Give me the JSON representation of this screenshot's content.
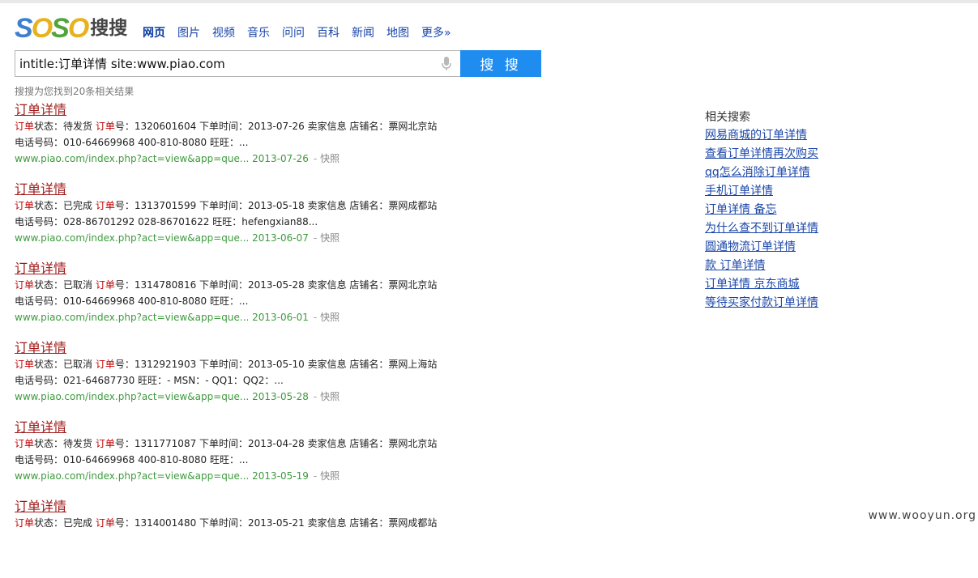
{
  "logo": {
    "text_soso": "SOSO",
    "text_cn": "搜搜"
  },
  "nav": [
    {
      "label": "网页",
      "active": true
    },
    {
      "label": "图片"
    },
    {
      "label": "视频"
    },
    {
      "label": "音乐"
    },
    {
      "label": "问问"
    },
    {
      "label": "百科"
    },
    {
      "label": "新闻"
    },
    {
      "label": "地图"
    },
    {
      "label": "更多»"
    }
  ],
  "search": {
    "query": "intitle:订单详情 site:www.piao.com",
    "button_label": "搜 搜"
  },
  "result_count": "搜搜为您找到20条相关结果",
  "results": [
    {
      "title": "订单详情",
      "line1_pre": "",
      "hl1": "订单",
      "mid1": "状态：待发货 ",
      "hl2": "订单",
      "rest": "号：1320601604 下单时间：2013-07-26 卖家信息 店铺名：票网北京站",
      "line2": "电话号码：010-64669968 400-810-8080 旺旺：...",
      "url": "www.piao.com/index.php?act=view&app=que...",
      "date": "2013-07-26",
      "snapshot": "快照"
    },
    {
      "title": "订单详情",
      "hl1": "订单",
      "mid1": "状态：已完成 ",
      "hl2": "订单",
      "rest": "号：1313701599 下单时间：2013-05-18 卖家信息 店铺名：票网成都站",
      "line2": "电话号码：028-86701292 028-86701622 旺旺：hefengxian88...",
      "url": "www.piao.com/index.php?act=view&app=que...",
      "date": "2013-06-07",
      "snapshot": "快照"
    },
    {
      "title": "订单详情",
      "hl1": "订单",
      "mid1": "状态：已取消 ",
      "hl2": "订单",
      "rest": "号：1314780816 下单时间：2013-05-28 卖家信息 店铺名：票网北京站",
      "line2": "电话号码：010-64669968 400-810-8080 旺旺：...",
      "url": "www.piao.com/index.php?act=view&app=que...",
      "date": "2013-06-01",
      "snapshot": "快照"
    },
    {
      "title": "订单详情",
      "hl1": "订单",
      "mid1": "状态：已取消 ",
      "hl2": "订单",
      "rest": "号：1312921903 下单时间：2013-05-10 卖家信息 店铺名：票网上海站",
      "line2": "电话号码：021-64687730 旺旺：- MSN：- QQ1：QQ2：...",
      "url": "www.piao.com/index.php?act=view&app=que...",
      "date": "2013-05-28",
      "snapshot": "快照"
    },
    {
      "title": "订单详情",
      "hl1": "订单",
      "mid1": "状态：待发货 ",
      "hl2": "订单",
      "rest": "号：1311771087 下单时间：2013-04-28 卖家信息 店铺名：票网北京站",
      "line2": "电话号码：010-64669968 400-810-8080 旺旺：...",
      "url": "www.piao.com/index.php?act=view&app=que...",
      "date": "2013-05-19",
      "snapshot": "快照"
    },
    {
      "title": "订单详情",
      "hl1": "订单",
      "mid1": "状态：已完成 ",
      "hl2": "订单",
      "rest": "号：1314001480 下单时间：2013-05-21 卖家信息 店铺名：票网成都站",
      "line2": "",
      "url": "",
      "date": "",
      "snapshot": ""
    }
  ],
  "related": {
    "title": "相关搜索",
    "items": [
      "网易商城的订单详情",
      "查看订单详情再次购买",
      "qq怎么消除订单详情",
      "手机订单详情",
      "订单详情 备忘",
      "为什么查不到订单详情",
      "圆通物流订单详情",
      "款 订单详情",
      "订单详情 京东商城",
      "等待买家付款订单详情"
    ]
  },
  "watermark": "www.wooyun.org",
  "colors": {
    "accent": "#1f8cf0",
    "title_link": "#a01c1c",
    "url_green": "#3e9a3e",
    "nav_link": "#1a46a8"
  }
}
